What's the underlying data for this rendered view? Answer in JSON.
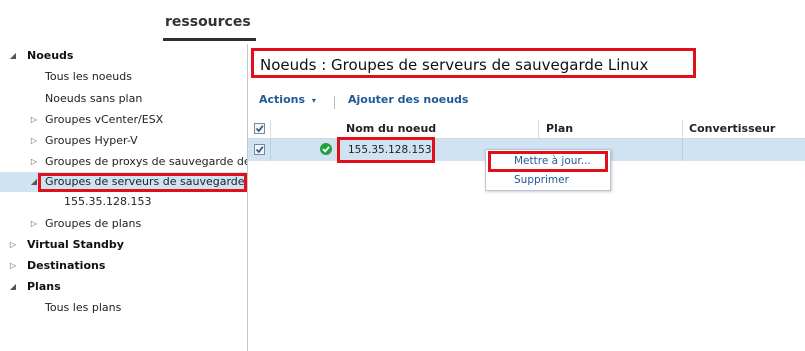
{
  "header": {
    "tab_label": "ressources"
  },
  "sidebar": {
    "items": [
      {
        "label": "Noeuds",
        "arrow": "◢"
      },
      {
        "label": "Tous les noeuds"
      },
      {
        "label": "Noeuds sans plan"
      },
      {
        "label": "Groupes vCenter/ESX",
        "arrow": "▷"
      },
      {
        "label": "Groupes Hyper-V",
        "arrow": "▷"
      },
      {
        "label": "Groupes de proxys de sauvegarde de m",
        "arrow": "▷"
      },
      {
        "label": "Groupes de serveurs de sauvegarde Lin",
        "arrow": "◢"
      },
      {
        "label": "155.35.128.153"
      },
      {
        "label": "Groupes de plans",
        "arrow": "▷"
      },
      {
        "label": "Virtual Standby",
        "arrow": "▷"
      },
      {
        "label": "Destinations",
        "arrow": "▷"
      },
      {
        "label": "Plans",
        "arrow": "◢"
      },
      {
        "label": "Tous les plans"
      }
    ]
  },
  "main": {
    "title": "Noeuds : Groupes de serveurs de sauvegarde Linux",
    "toolbar": {
      "actions_label": "Actions",
      "actions_caret": "▾",
      "add_nodes_label": "Ajouter des noeuds"
    },
    "grid": {
      "columns": [
        "Nom du noeud",
        "Plan",
        "Convertisseur"
      ],
      "rows": [
        {
          "node_name": "155.35.128.153",
          "plan": "",
          "converter": ""
        }
      ]
    },
    "context_menu": {
      "items": [
        "Mettre à jour...",
        "Supprimer"
      ]
    }
  },
  "colors": {
    "highlight_red": "#e0101a",
    "selection_blue": "#cfe3f3",
    "link_blue": "#1f5a96",
    "status_green": "#1fa33a"
  },
  "icons": {
    "status": "check-circle-icon",
    "tree_expanded": "triangle-down-icon",
    "tree_collapsed": "triangle-right-icon"
  }
}
